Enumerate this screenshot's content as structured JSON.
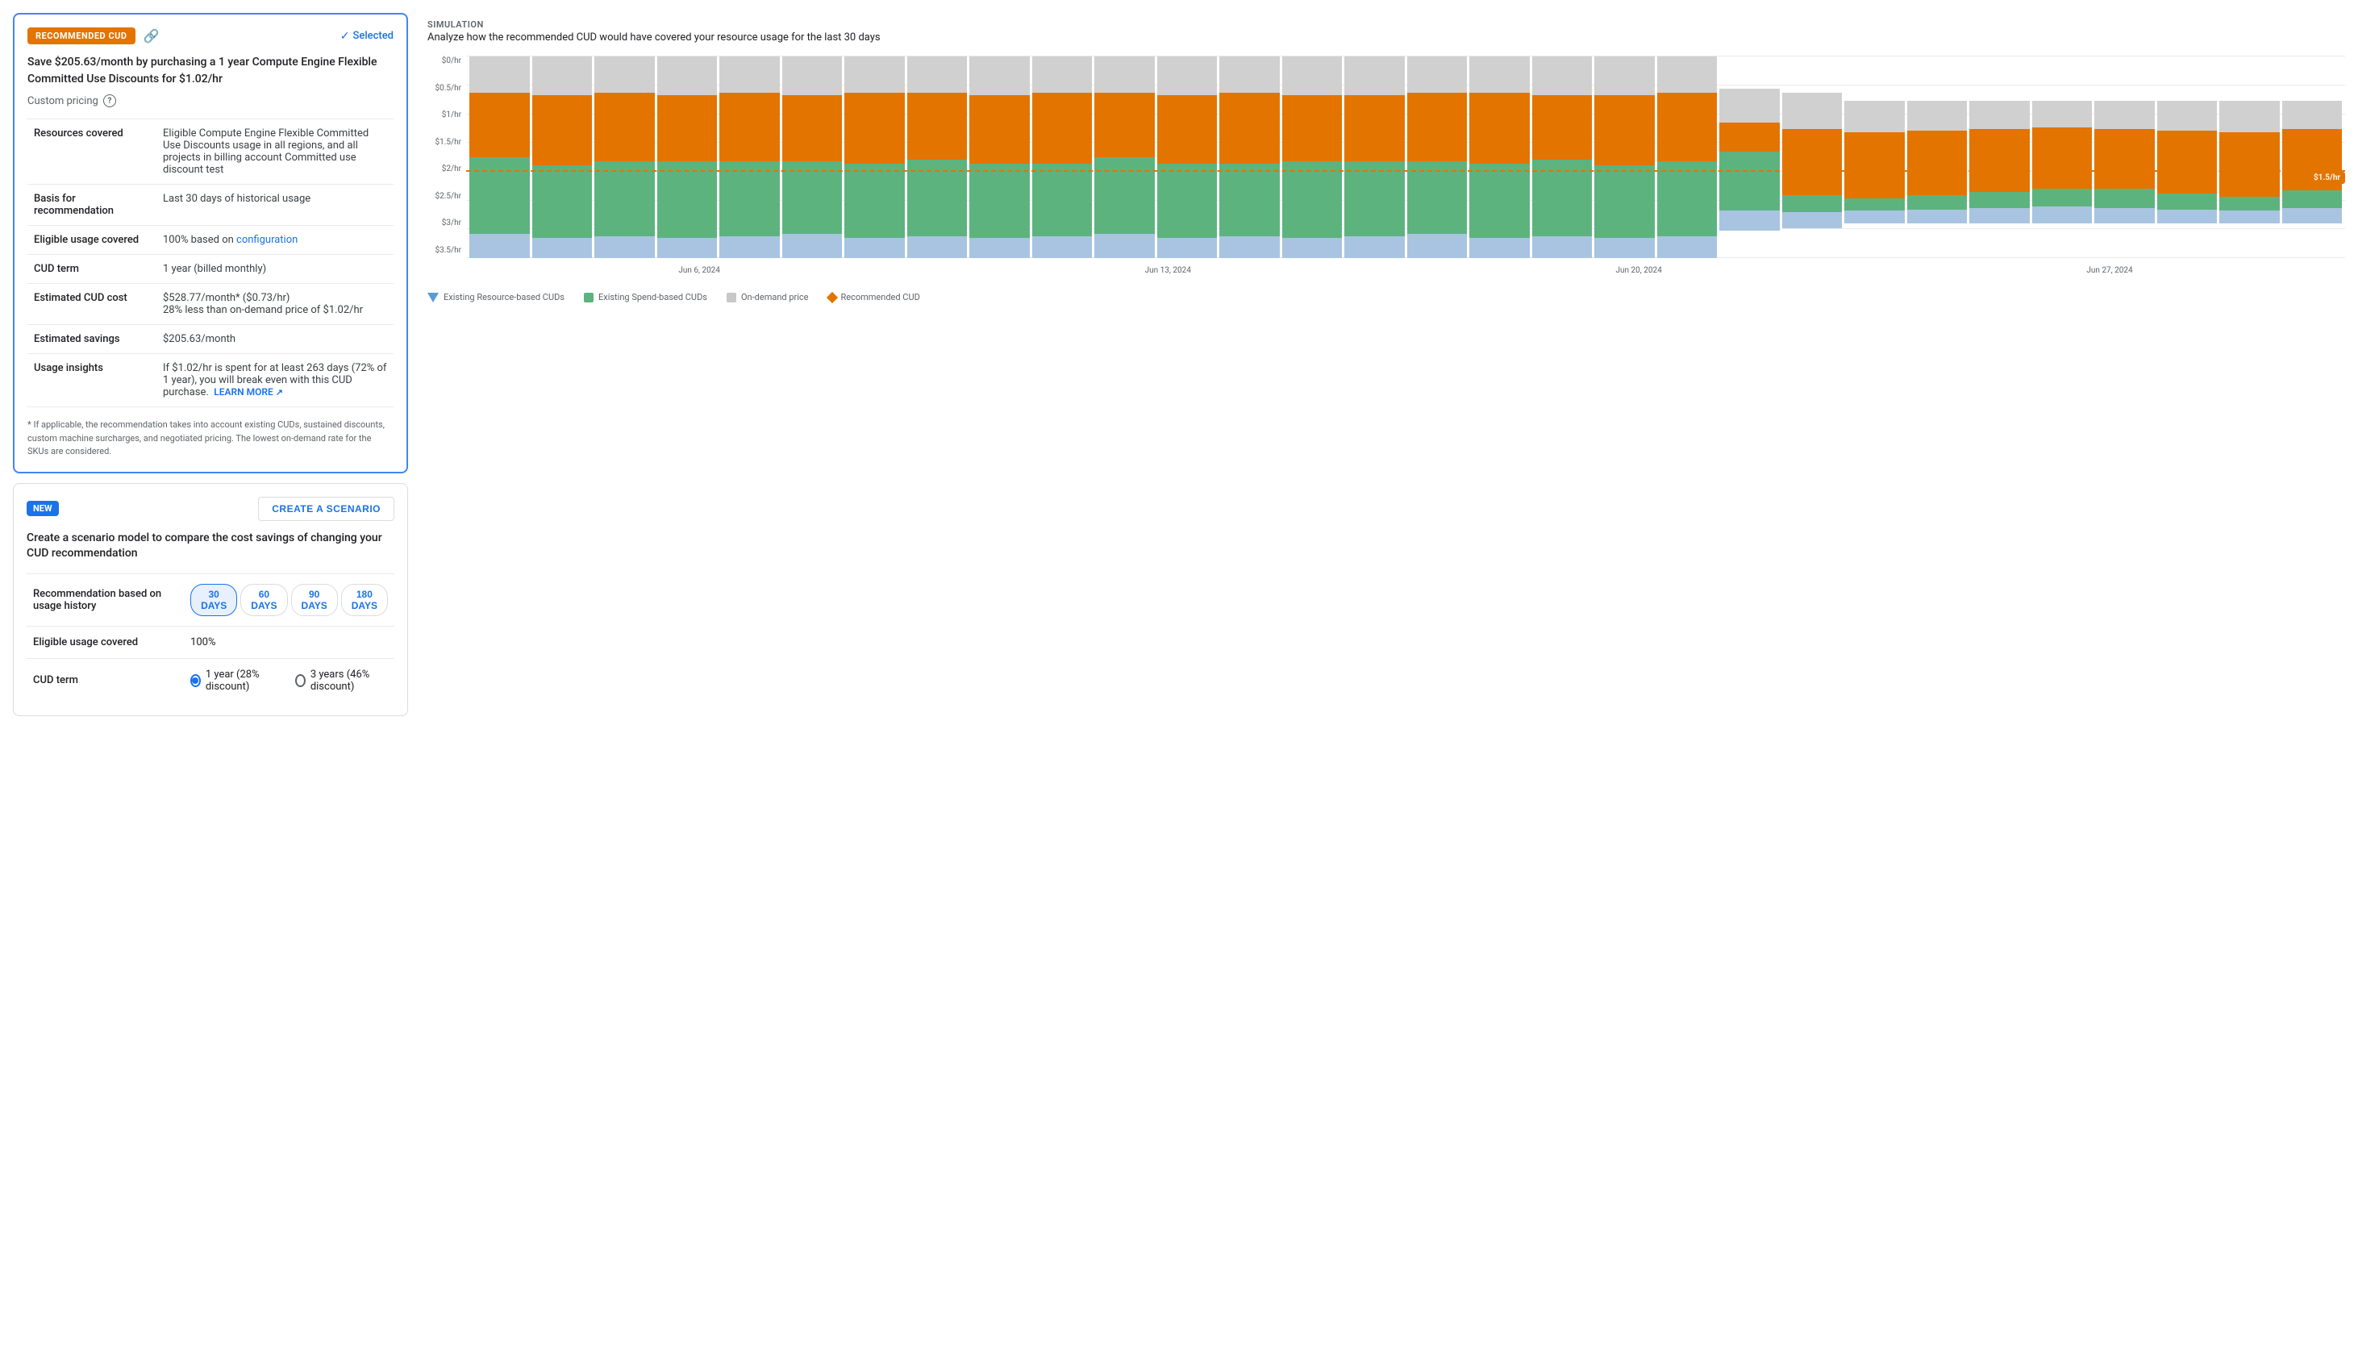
{
  "rec_badge": "RECOMMENDED CUD",
  "selected_label": "Selected",
  "title": "Save $205.63/month by purchasing a 1 year Compute Engine Flexible Committed Use Discounts for $1.02/hr",
  "custom_pricing_label": "Custom pricing",
  "table_rows": [
    {
      "label": "Resources covered",
      "value": "Eligible Compute Engine Flexible Committed Use Discounts usage in all regions, and all projects in billing account Committed use discount test",
      "has_link": false
    },
    {
      "label": "Basis for recommendation",
      "value": "Last 30 days of historical usage",
      "has_link": false
    },
    {
      "label": "Eligible usage covered",
      "value_prefix": "100% based on ",
      "link_text": "configuration",
      "value_suffix": "",
      "has_link": true
    },
    {
      "label": "CUD term",
      "value": "1 year (billed monthly)",
      "has_link": false
    },
    {
      "label": "Estimated CUD cost",
      "value": "$528.77/month* ($0.73/hr)\n28% less than on-demand price of $1.02/hr",
      "has_link": false
    },
    {
      "label": "Estimated savings",
      "value": "$205.63/month",
      "has_link": false
    },
    {
      "label": "Usage insights",
      "value_prefix": "If $1.02/hr is spent for at least 263 days (72% of 1 year), you will break even with this CUD purchase.  ",
      "link_text": "LEARN MORE",
      "value_suffix": " ↗",
      "has_link": true
    }
  ],
  "footnote": "* If applicable, the recommendation takes into account existing CUDs, sustained discounts, custom machine surcharges, and negotiated pricing. The lowest on-demand rate for the SKUs are considered.",
  "scenario": {
    "new_badge": "NEW",
    "create_btn": "CREATE A SCENARIO",
    "title": "Create a scenario model to compare the cost savings of changing your CUD recommendation",
    "rows": [
      {
        "label": "Recommendation based on usage history",
        "type": "day_buttons"
      },
      {
        "label": "Eligible usage covered",
        "type": "text",
        "value": "100%"
      },
      {
        "label": "CUD term",
        "type": "radio"
      }
    ],
    "day_buttons": [
      "30 DAYS",
      "60 DAYS",
      "90 DAYS",
      "180 DAYS"
    ],
    "day_active": 0,
    "radio_options": [
      "1 year (28% discount)",
      "3 years (46% discount)"
    ],
    "radio_selected": 0
  },
  "simulation": {
    "label": "Simulation",
    "subtitle": "Analyze how the recommended CUD would have covered your resource usage for the last 30 days",
    "dashed_value": "$1.5/hr",
    "y_labels": [
      "$0/hr",
      "$0.5/hr",
      "$1/hr",
      "$1.5/hr",
      "$2/hr",
      "$2.5/hr",
      "$3/hr",
      "$3.5/hr"
    ],
    "x_labels": [
      "Jun 6, 2024",
      "Jun 13, 2024",
      "Jun 20, 2024",
      "Jun 27, 2024"
    ],
    "legend": [
      {
        "type": "triangle",
        "label": "Existing Resource-based CUDs"
      },
      {
        "type": "square",
        "color": "#5db37e",
        "label": "Existing Spend-based CUDs"
      },
      {
        "type": "square",
        "color": "#c8c8c8",
        "label": "On-demand price"
      },
      {
        "type": "diamond",
        "color": "#e37400",
        "label": "Recommended CUD"
      }
    ],
    "bars": [
      {
        "blue": 12,
        "green": 38,
        "orange": 32,
        "gray": 18
      },
      {
        "blue": 10,
        "green": 36,
        "orange": 35,
        "gray": 19
      },
      {
        "blue": 11,
        "green": 37,
        "orange": 34,
        "gray": 18
      },
      {
        "blue": 10,
        "green": 38,
        "orange": 33,
        "gray": 19
      },
      {
        "blue": 11,
        "green": 37,
        "orange": 34,
        "gray": 18
      },
      {
        "blue": 12,
        "green": 36,
        "orange": 33,
        "gray": 19
      },
      {
        "blue": 10,
        "green": 37,
        "orange": 35,
        "gray": 18
      },
      {
        "blue": 11,
        "green": 38,
        "orange": 33,
        "gray": 18
      },
      {
        "blue": 10,
        "green": 37,
        "orange": 34,
        "gray": 19
      },
      {
        "blue": 11,
        "green": 36,
        "orange": 35,
        "gray": 18
      },
      {
        "blue": 12,
        "green": 38,
        "orange": 32,
        "gray": 18
      },
      {
        "blue": 10,
        "green": 37,
        "orange": 34,
        "gray": 19
      },
      {
        "blue": 11,
        "green": 36,
        "orange": 35,
        "gray": 18
      },
      {
        "blue": 10,
        "green": 38,
        "orange": 33,
        "gray": 19
      },
      {
        "blue": 11,
        "green": 37,
        "orange": 33,
        "gray": 19
      },
      {
        "blue": 12,
        "green": 36,
        "orange": 34,
        "gray": 18
      },
      {
        "blue": 10,
        "green": 37,
        "orange": 35,
        "gray": 18
      },
      {
        "blue": 11,
        "green": 38,
        "orange": 32,
        "gray": 19
      },
      {
        "blue": 10,
        "green": 36,
        "orange": 35,
        "gray": 19
      },
      {
        "blue": 11,
        "green": 37,
        "orange": 34,
        "gray": 18
      },
      {
        "blue": 12,
        "green": 35,
        "orange": 17,
        "gray": 20
      },
      {
        "blue": 10,
        "green": 10,
        "orange": 40,
        "gray": 22
      },
      {
        "blue": 8,
        "green": 8,
        "orange": 42,
        "gray": 20
      },
      {
        "blue": 9,
        "green": 9,
        "orange": 41,
        "gray": 19
      },
      {
        "blue": 10,
        "green": 10,
        "orange": 40,
        "gray": 18
      },
      {
        "blue": 11,
        "green": 11,
        "orange": 39,
        "gray": 17
      },
      {
        "blue": 10,
        "green": 12,
        "orange": 38,
        "gray": 18
      },
      {
        "blue": 9,
        "green": 10,
        "orange": 40,
        "gray": 19
      },
      {
        "blue": 8,
        "green": 9,
        "orange": 41,
        "gray": 20
      },
      {
        "blue": 10,
        "green": 11,
        "orange": 39,
        "gray": 18
      }
    ]
  }
}
